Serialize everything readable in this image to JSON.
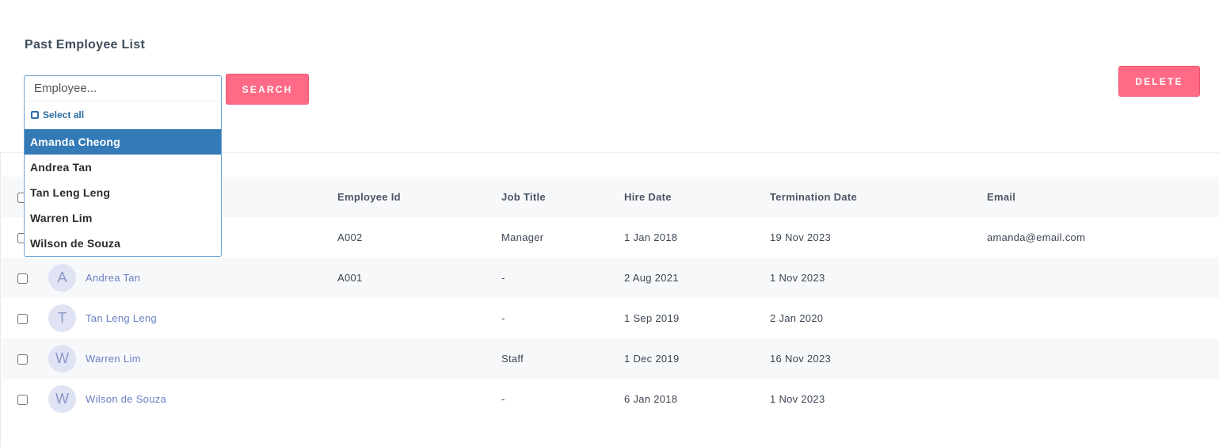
{
  "page": {
    "title": "Past Employee List"
  },
  "search": {
    "placeholder": "Employee...",
    "button_label": "SEARCH"
  },
  "actions": {
    "delete_label": "DELETE"
  },
  "dropdown": {
    "select_all_label": "Select all",
    "options": [
      {
        "label": "Amanda Cheong",
        "highlighted": true
      },
      {
        "label": "Andrea Tan",
        "highlighted": false
      },
      {
        "label": "Tan Leng Leng",
        "highlighted": false
      },
      {
        "label": "Warren Lim",
        "highlighted": false
      },
      {
        "label": "Wilson de Souza",
        "highlighted": false
      }
    ]
  },
  "table": {
    "columns": [
      "Employee Id",
      "Job Title",
      "Hire Date",
      "Termination Date",
      "Email"
    ],
    "rows": [
      {
        "initial": "",
        "name": "",
        "employee_id": "A002",
        "job_title": "Manager",
        "hire_date": "1 Jan 2018",
        "termination_date": "19 Nov 2023",
        "email": "amanda@email.com"
      },
      {
        "initial": "A",
        "name": "Andrea Tan",
        "employee_id": "A001",
        "job_title": "-",
        "hire_date": "2 Aug 2021",
        "termination_date": "1 Nov 2023",
        "email": ""
      },
      {
        "initial": "T",
        "name": "Tan Leng Leng",
        "employee_id": "",
        "job_title": "-",
        "hire_date": "1 Sep 2019",
        "termination_date": "2 Jan 2020",
        "email": ""
      },
      {
        "initial": "W",
        "name": "Warren Lim",
        "employee_id": "",
        "job_title": "Staff",
        "hire_date": "1 Dec 2019",
        "termination_date": "16 Nov 2023",
        "email": ""
      },
      {
        "initial": "W",
        "name": "Wilson de Souza",
        "employee_id": "",
        "job_title": "-",
        "hire_date": "6 Jan 2018",
        "termination_date": "1 Nov 2023",
        "email": ""
      }
    ]
  },
  "colors": {
    "accent_button": "#ff6b86",
    "dropdown_highlight": "#337ab7",
    "link": "#6b7fc4",
    "avatar_bg": "#dfe3f3"
  }
}
